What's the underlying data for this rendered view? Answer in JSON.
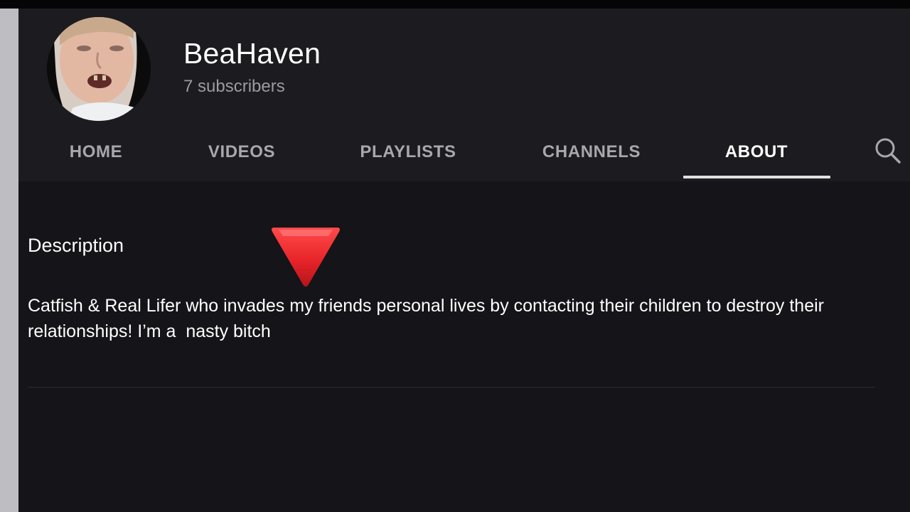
{
  "channel": {
    "name": "BeaHaven",
    "subscribers": "7 subscribers"
  },
  "tabs": [
    {
      "label": "HOME",
      "active": false
    },
    {
      "label": "VIDEOS",
      "active": false
    },
    {
      "label": "PLAYLISTS",
      "active": false
    },
    {
      "label": "CHANNELS",
      "active": false
    },
    {
      "label": "ABOUT",
      "active": true
    }
  ],
  "search": {
    "icon": "search-icon"
  },
  "about": {
    "section_title": "Description",
    "description": "Catfish & Real Lifer who invades my friends personal lives by contacting their children to destroy their relationships! I’m a  nasty bitch"
  },
  "marker": {
    "icon": "red-triangle-down-icon",
    "color": "#e8252a"
  },
  "colors": {
    "background": "#151418",
    "header": "#1c1b1f",
    "active_tab": "#ffffff",
    "inactive_tab": "#a8a8ac"
  }
}
